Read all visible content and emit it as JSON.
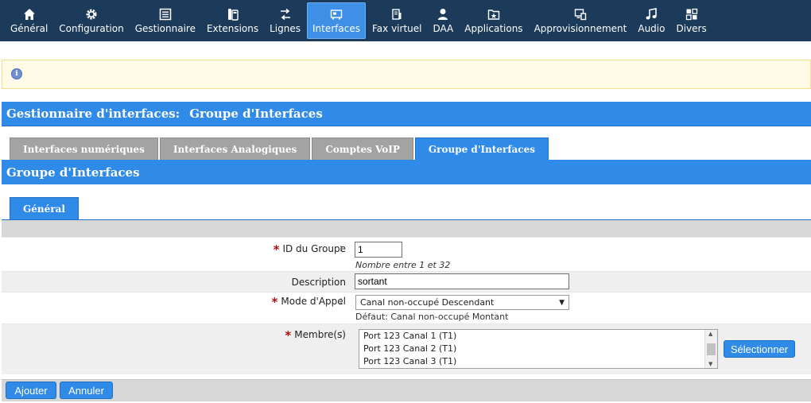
{
  "nav": {
    "items": [
      {
        "label": "Général",
        "icon": "home-icon"
      },
      {
        "label": "Configuration",
        "icon": "gear-icon"
      },
      {
        "label": "Gestionnaire",
        "icon": "list-icon"
      },
      {
        "label": "Extensions",
        "icon": "phone-icon"
      },
      {
        "label": "Lignes",
        "icon": "route-icon"
      },
      {
        "label": "Interfaces",
        "icon": "card-icon"
      },
      {
        "label": "Fax virtuel",
        "icon": "fax-icon"
      },
      {
        "label": "DAA",
        "icon": "person-icon"
      },
      {
        "label": "Applications",
        "icon": "folder-star-icon"
      },
      {
        "label": "Approvisionnement",
        "icon": "devices-icon"
      },
      {
        "label": "Audio",
        "icon": "music-icon"
      },
      {
        "label": "Divers",
        "icon": "grid-icon"
      }
    ],
    "active_index": 5
  },
  "page": {
    "title_part1": "Gestionnaire d'interfaces:",
    "title_part2": "Groupe d'Interfaces",
    "section_title": "Groupe d'Interfaces"
  },
  "tabs": [
    {
      "label": "Interfaces numériques",
      "active": false
    },
    {
      "label": "Interfaces Analogiques",
      "active": false
    },
    {
      "label": "Comptes VoIP",
      "active": false
    },
    {
      "label": "Groupe d'Interfaces",
      "active": true
    }
  ],
  "subtabs": [
    {
      "label": "Général"
    }
  ],
  "form": {
    "group_id": {
      "label": "ID du Groupe",
      "value": "1",
      "hint": "Nombre entre 1 et 32",
      "required": true
    },
    "description": {
      "label": "Description",
      "value": "sortant",
      "required": false
    },
    "call_mode": {
      "label": "Mode d'Appel",
      "value": "Canal non-occupé Descendant",
      "hint": "Défaut: Canal non-occupé Montant",
      "required": true
    },
    "members": {
      "label": "Membre(s)",
      "required": true,
      "options": [
        "Port 123 Canal 1 (T1)",
        "Port 123 Canal 2 (T1)",
        "Port 123 Canal 3 (T1)"
      ],
      "select_button": "Sélectionner"
    },
    "colon": ":",
    "required_mark": "*"
  },
  "actions": {
    "add": "Ajouter",
    "cancel": "Annuler"
  },
  "colors": {
    "nav_bg": "#1c3a5a",
    "accent": "#2f8ae8",
    "required": "#b01010"
  }
}
